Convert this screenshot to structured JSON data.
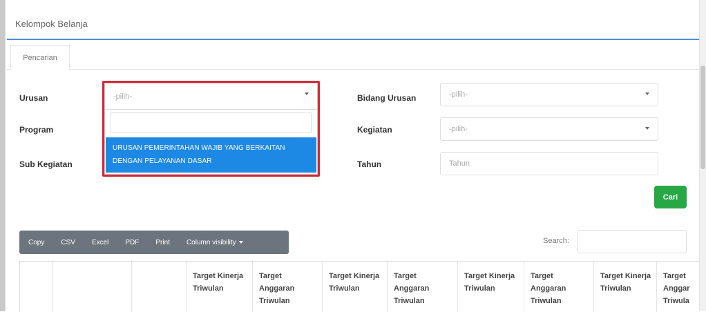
{
  "header": {
    "title": "Kelompok Belanja"
  },
  "tabs": {
    "search_tab": "Pencarian"
  },
  "form": {
    "urusan": {
      "label": "Urusan",
      "value": "-pilih-"
    },
    "program": {
      "label": "Program"
    },
    "sub_kegiatan": {
      "label": "Sub Kegiatan"
    },
    "bidang_urusan": {
      "label": "Bidang Urusan",
      "value": "-pilih-"
    },
    "kegiatan": {
      "label": "Kegiatan",
      "value": "-pilih-"
    },
    "tahun": {
      "label": "Tahun",
      "placeholder": "Tahun"
    },
    "dropdown_option": "URUSAN PEMERINTAHAN WAJIB YANG BERKAITAN DENGAN PELAYANAN DASAR",
    "cari_label": "Cari"
  },
  "toolbar": {
    "buttons": [
      "Copy",
      "CSV",
      "Excel",
      "PDF",
      "Print",
      "Column visibility"
    ]
  },
  "table": {
    "search_label": "Search:",
    "headers": [
      "Target Kinerja Triwulan",
      "Target Anggaran Triwulan",
      "Target Kinerja Triwulan",
      "Target Anggaran Triwulan",
      "Target Kinerja Triwulan",
      "Target Anggaran Triwulan",
      "Target Kinerja Triwulan",
      "Target Anggar Triwula"
    ]
  },
  "colors": {
    "accent": "#4a8fd9",
    "highlight": "#d62735",
    "selected": "#1e88e5",
    "button_green": "#28a745",
    "toolbar": "#6c757d"
  }
}
